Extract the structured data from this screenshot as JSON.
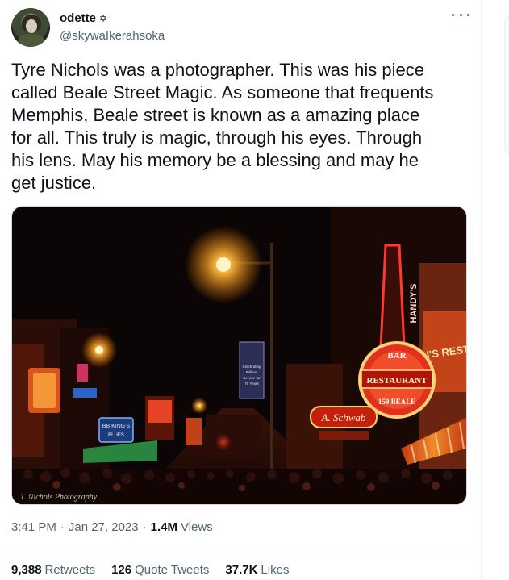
{
  "author": {
    "display_name": "odette",
    "badge_glyph": "✡",
    "handle": "@skywaIkerahsoka"
  },
  "tweet": {
    "text": "Tyre Nichols was a photographer. This was his piece\ncalled Beale Street Magic. As someone that frequents\nMemphis, Beale street is known as a amazing place\nfor all. This truly is magic, through his eyes. Through\nhis lens. May his memory be a blessing and may he\nget justice."
  },
  "media": {
    "signs": {
      "bar": "BAR",
      "restaurant": "RESTAURANT",
      "address": "159 BEALE",
      "schwab": "A. Schwab",
      "tall_sign": "HANDY'S",
      "side_sign": "N'S REST",
      "banner_small": "Celebrating Brilliant Service for 75 Years",
      "banner_mid": "BB KING'S",
      "banner_left": "BLUES"
    },
    "watermark": "T. Nichols Photography"
  },
  "meta": {
    "time": "3:41 PM",
    "date": "Jan 27, 2023",
    "views_count": "1.4M",
    "views_label": "Views",
    "sep": "·"
  },
  "stats": {
    "retweets_count": "9,388",
    "retweets_label": "Retweets",
    "quotes_count": "126",
    "quotes_label": "Quote Tweets",
    "likes_count": "37.7K",
    "likes_label": "Likes"
  },
  "colors": {
    "text": "#0f1419",
    "secondary": "#536471",
    "divider": "#eff3f4",
    "neon_red": "#ff3b2f",
    "neon_orange": "#ff8a1e",
    "lamp": "#ffd36b"
  }
}
